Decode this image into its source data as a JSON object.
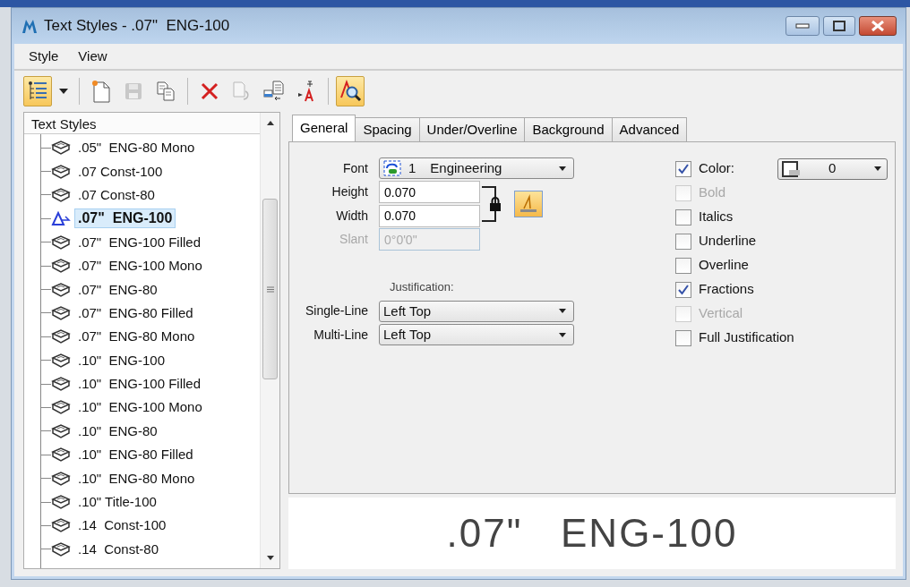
{
  "window": {
    "title": "Text Styles - .07\"  ENG-100"
  },
  "menu": [
    {
      "label": "Style"
    },
    {
      "label": "View"
    }
  ],
  "toolbar": [
    {
      "kind": "list-view",
      "active": true,
      "disabled": false
    },
    {
      "kind": "dropdown",
      "active": false,
      "disabled": false
    },
    {
      "kind": "new",
      "active": false,
      "disabled": false
    },
    {
      "kind": "save",
      "active": false,
      "disabled": true
    },
    {
      "kind": "copy",
      "active": false,
      "disabled": false
    },
    {
      "kind": "delete",
      "active": false,
      "disabled": false
    },
    {
      "kind": "reset",
      "active": false,
      "disabled": true
    },
    {
      "kind": "import",
      "active": false,
      "disabled": false
    },
    {
      "kind": "export",
      "active": false,
      "disabled": false
    },
    {
      "kind": "preview",
      "active": true,
      "disabled": false
    }
  ],
  "tree": {
    "header": "Text Styles",
    "items": [
      {
        "label": ".05\"  ENG-80 Mono",
        "selected": false
      },
      {
        "label": ".07 Const-100",
        "selected": false
      },
      {
        "label": ".07 Const-80",
        "selected": false
      },
      {
        "label": ".07\"  ENG-100",
        "selected": true
      },
      {
        "label": ".07\"  ENG-100 Filled",
        "selected": false
      },
      {
        "label": ".07\"  ENG-100 Mono",
        "selected": false
      },
      {
        "label": ".07\"  ENG-80",
        "selected": false
      },
      {
        "label": ".07\"  ENG-80 Filled",
        "selected": false
      },
      {
        "label": ".07\"  ENG-80 Mono",
        "selected": false
      },
      {
        "label": ".10\"  ENG-100",
        "selected": false
      },
      {
        "label": ".10\"  ENG-100 Filled",
        "selected": false
      },
      {
        "label": ".10\"  ENG-100 Mono",
        "selected": false
      },
      {
        "label": ".10\"  ENG-80",
        "selected": false
      },
      {
        "label": ".10\"  ENG-80 Filled",
        "selected": false
      },
      {
        "label": ".10\"  ENG-80 Mono",
        "selected": false
      },
      {
        "label": ".10\" Title-100",
        "selected": false
      },
      {
        "label": ".14  Const-100",
        "selected": false
      },
      {
        "label": ".14  Const-80",
        "selected": false
      }
    ]
  },
  "tabs": [
    {
      "label": "General",
      "selected": true
    },
    {
      "label": "Spacing",
      "selected": false
    },
    {
      "label": "Under/Overline",
      "selected": false
    },
    {
      "label": "Background",
      "selected": false
    },
    {
      "label": "Advanced",
      "selected": false
    }
  ],
  "general": {
    "font": {
      "label": "Font",
      "number": "1",
      "name": "Engineering"
    },
    "height": {
      "label": "Height",
      "value": "0.070",
      "disabled": false
    },
    "width": {
      "label": "Width",
      "value": "0.070",
      "disabled": false
    },
    "slant": {
      "label": "Slant",
      "value": "0°0'0\"",
      "disabled": true
    },
    "size_lock": {
      "locked": true
    },
    "justification": {
      "label": "Justification:",
      "single_line": {
        "label": "Single-Line",
        "value": "Left Top"
      },
      "multi_line": {
        "label": "Multi-Line",
        "value": "Left Top"
      }
    },
    "options": [
      {
        "label": "Color:",
        "checked": true,
        "disabled": false
      },
      {
        "label": "Bold",
        "checked": false,
        "disabled": true
      },
      {
        "label": "Italics",
        "checked": false,
        "disabled": false
      },
      {
        "label": "Underline",
        "checked": false,
        "disabled": false
      },
      {
        "label": "Overline",
        "checked": false,
        "disabled": false
      },
      {
        "label": "Fractions",
        "checked": true,
        "disabled": false
      },
      {
        "label": "Vertical",
        "checked": false,
        "disabled": true
      },
      {
        "label": "Full Justification",
        "checked": false,
        "disabled": false
      }
    ],
    "color": {
      "value": "0"
    }
  },
  "preview": {
    "text": ".07\"   ENG-100"
  }
}
